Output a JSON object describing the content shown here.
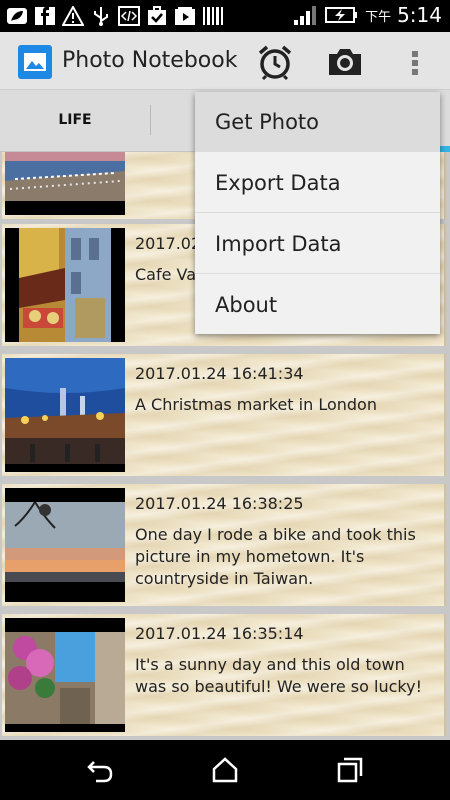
{
  "status_bar": {
    "time": "5:14",
    "ampm": "下午",
    "icons": [
      "leaf-icon",
      "facebook-icon",
      "alert-icon",
      "usb-icon",
      "code-icon",
      "check-bag-icon",
      "play-box-icon",
      "barcode-icon",
      "signal-icon",
      "battery-charging-icon"
    ]
  },
  "action_bar": {
    "title": "Photo Notebook",
    "icons": [
      "app-photo-icon",
      "alarm-icon",
      "camera-icon",
      "overflow-menu-icon"
    ]
  },
  "tabs": {
    "items": [
      {
        "label": "LIFE"
      }
    ]
  },
  "list": {
    "items": [
      {
        "date": "",
        "desc": "",
        "thumb": "beach-photo"
      },
      {
        "date": "2017.02",
        "desc": "Cafe Va",
        "thumb": "cafe-photo"
      },
      {
        "date": "2017.01.24 16:41:34",
        "desc": "A Christmas market in London",
        "thumb": "christmas-market-photo"
      },
      {
        "date": "2017.01.24 16:38:25",
        "desc": "One day I rode a bike and took this picture in my hometown. It's countryside in Taiwan.",
        "thumb": "sunset-photo"
      },
      {
        "date": "2017.01.24 16:35:14",
        "desc": "It's a sunny day and this old town was so beautiful! We were so lucky!",
        "thumb": "old-town-photo"
      }
    ]
  },
  "menu": {
    "items": [
      {
        "label": "Get Photo"
      },
      {
        "label": "Export Data"
      },
      {
        "label": "Import Data"
      },
      {
        "label": "About"
      }
    ]
  },
  "nav_bar": {
    "icons": [
      "back-icon",
      "home-icon",
      "recents-icon"
    ]
  }
}
